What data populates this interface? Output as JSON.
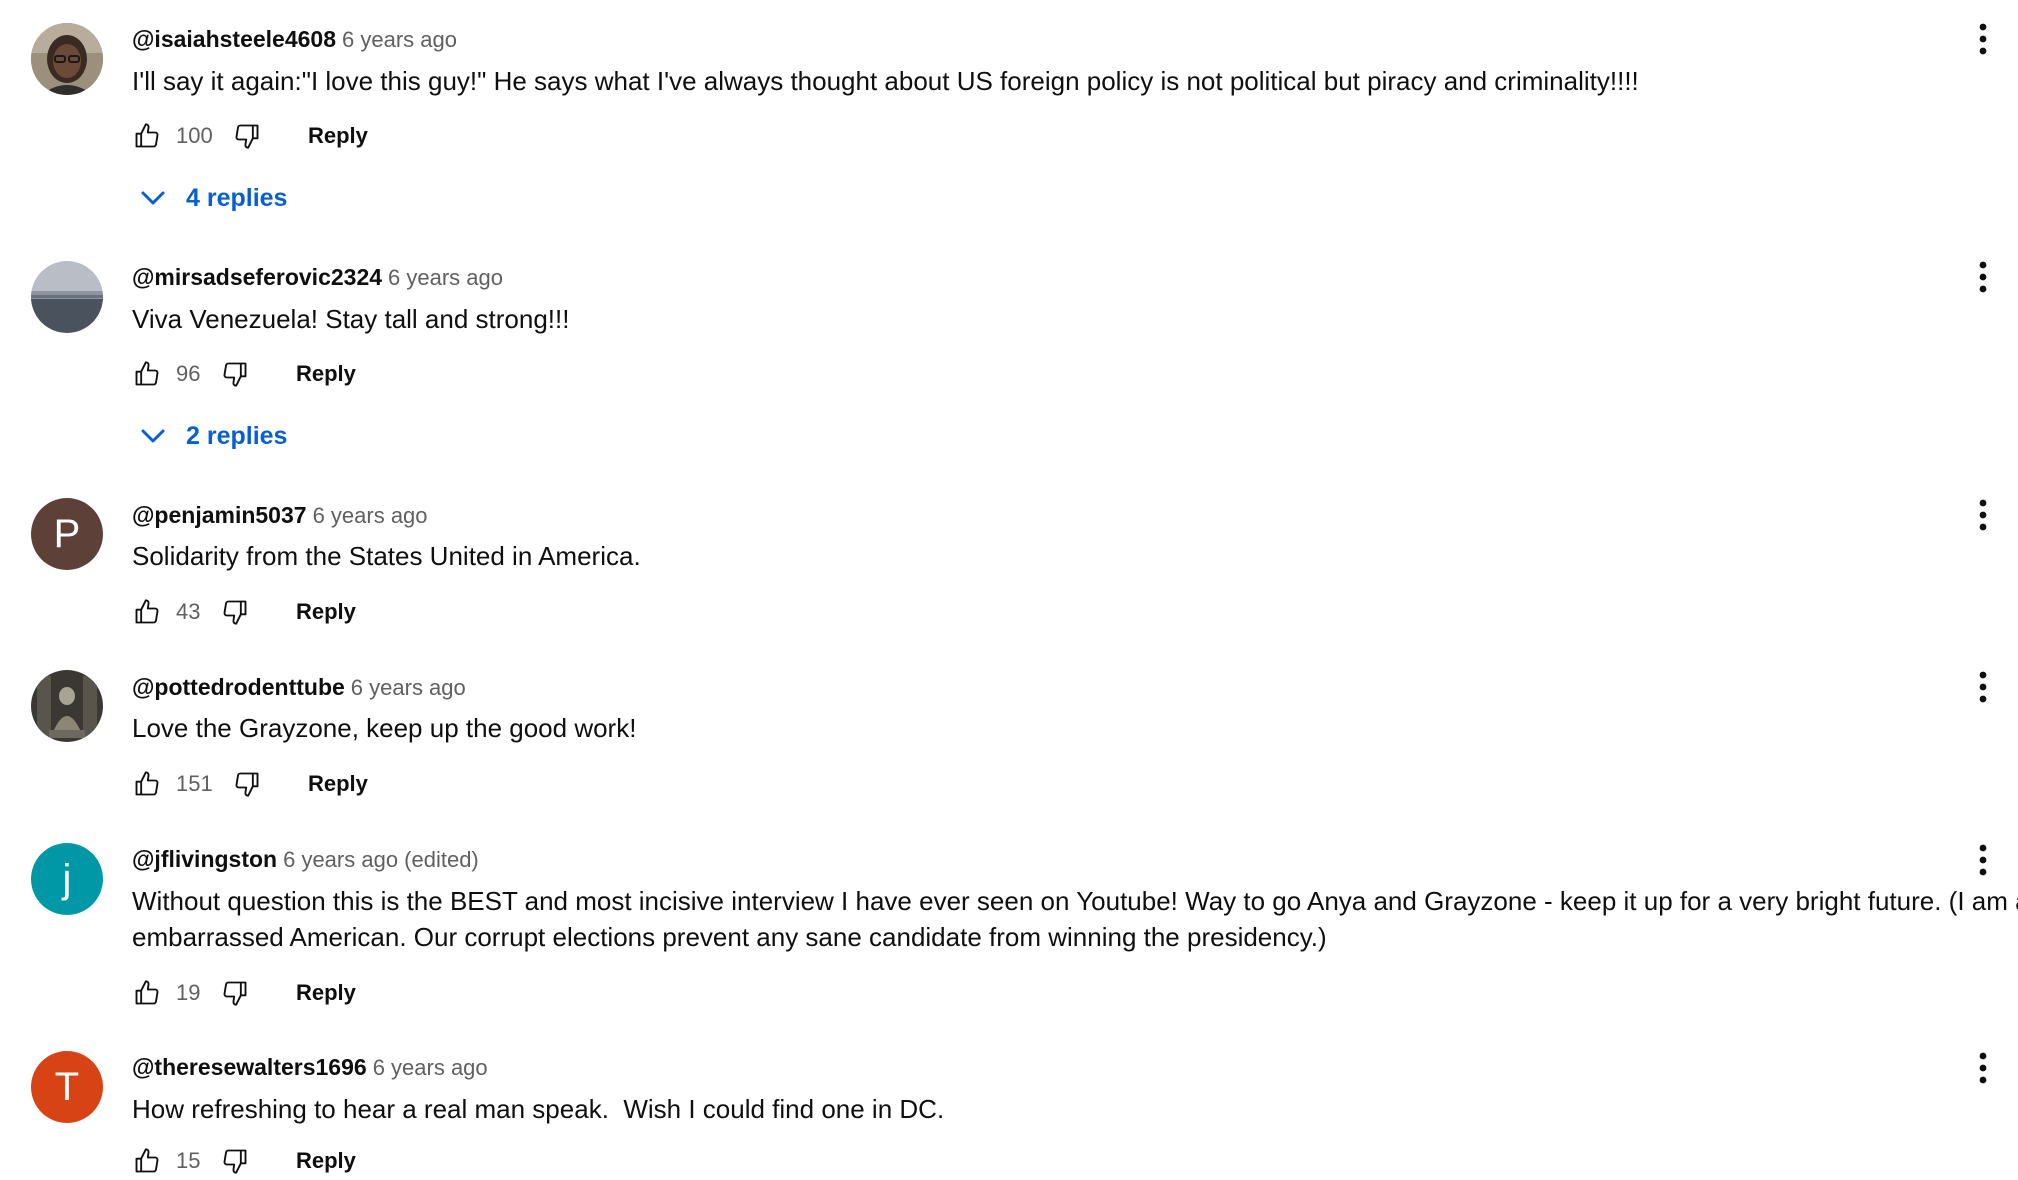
{
  "comments": [
    {
      "author": "@isaiahsteele4608",
      "time": "6 years ago",
      "text": "I'll say it again:\"I love this guy!\" He says what I've always thought about US foreign policy is not political but piracy and criminality!!!!",
      "likes": "100",
      "reply_label": "Reply",
      "replies_label": "4 replies",
      "avatar": {
        "type": "photo",
        "icon": "person-photo-avatar"
      }
    },
    {
      "author": "@mirsadseferovic2324",
      "time": "6 years ago",
      "text": "Viva Venezuela! Stay tall and strong!!!",
      "likes": "96",
      "reply_label": "Reply",
      "replies_label": "2 replies",
      "avatar": {
        "type": "photo",
        "icon": "landscape-photo-avatar"
      }
    },
    {
      "author": "@penjamin5037",
      "time": "6 years ago",
      "text": "Solidarity from the States United in America.",
      "likes": "43",
      "reply_label": "Reply",
      "avatar": {
        "type": "letter",
        "letter": "P",
        "color": "#5d4037"
      }
    },
    {
      "author": "@pottedrodenttube",
      "time": "6 years ago",
      "text": "Love the Grayzone, keep up the good work!",
      "likes": "151",
      "reply_label": "Reply",
      "avatar": {
        "type": "photo",
        "icon": "statue-photo-avatar"
      }
    },
    {
      "author": "@jflivingston",
      "time": "6 years ago (edited)",
      "text_lines": [
        "Without question this is the BEST and most incisive interview I have ever seen on Youtube!  Way to go Anya and Grayzone - keep it up for a very bright future.  (I am an",
        "embarrassed American.  Our corrupt elections prevent any sane candidate from winning the presidency.)"
      ],
      "likes": "19",
      "reply_label": "Reply",
      "avatar": {
        "type": "letter",
        "letter": "j",
        "color": "#0097a7"
      }
    },
    {
      "author": "@theresewalters1696",
      "time": "6 years ago",
      "text": "How refreshing to hear a real man speak.  Wish I could find one in DC.",
      "likes": "15",
      "reply_label": "Reply",
      "avatar": {
        "type": "letter",
        "letter": "T",
        "color": "#d84315"
      }
    }
  ],
  "colors": {
    "link_blue": "#065fd4",
    "meta_gray": "#606060",
    "text": "#0f0f0f"
  },
  "icons": {
    "like": "thumb-up-icon",
    "dislike": "thumb-down-icon",
    "more": "more-vert-icon",
    "expand": "chevron-down-icon"
  }
}
